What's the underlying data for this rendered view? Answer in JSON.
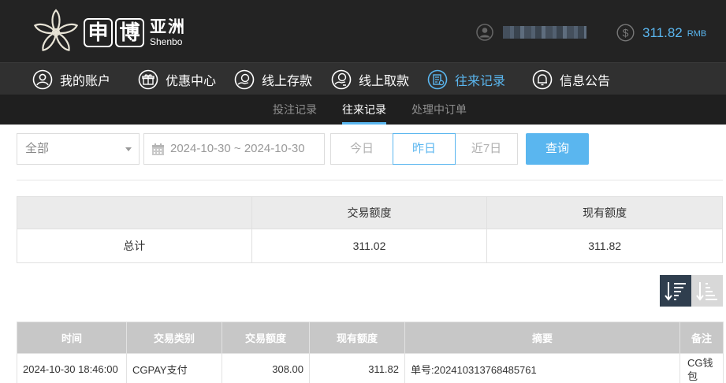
{
  "header": {
    "logo_chars": [
      "申",
      "博"
    ],
    "logo_cn": "亚洲",
    "logo_en": "Shenbo",
    "balance": "311.82",
    "balance_unit": "RMB",
    "accent": "#5ab6ef"
  },
  "nav": {
    "items": [
      {
        "label": "我的账户",
        "icon": "user-circle-icon"
      },
      {
        "label": "优惠中心",
        "icon": "gift-icon"
      },
      {
        "label": "线上存款",
        "icon": "deposit-icon"
      },
      {
        "label": "线上取款",
        "icon": "withdraw-icon"
      },
      {
        "label": "往来记录",
        "icon": "records-icon",
        "active": true
      },
      {
        "label": "信息公告",
        "icon": "bell-icon"
      }
    ]
  },
  "subnav": {
    "tabs": [
      {
        "label": "投注记录"
      },
      {
        "label": "往来记录",
        "active": true
      },
      {
        "label": "处理中订单"
      }
    ]
  },
  "filters": {
    "type_value": "全部",
    "date_range": "2024-10-30 ~ 2024-10-30",
    "quick": [
      "今日",
      "昨日",
      "近7日"
    ],
    "quick_active": "昨日",
    "query_label": "查询"
  },
  "summary": {
    "headers": [
      "",
      "交易额度",
      "现有额度"
    ],
    "row": [
      "总计",
      "311.02",
      "311.82"
    ]
  },
  "records": {
    "headers": [
      "时间",
      "交易类别",
      "交易额度",
      "现有额度",
      "摘要",
      "备注"
    ],
    "rows": [
      [
        "2024-10-30 18:46:00",
        "CGPAY支付",
        "308.00",
        "311.82",
        "单号:202410313768485761",
        "CG钱包"
      ]
    ]
  }
}
